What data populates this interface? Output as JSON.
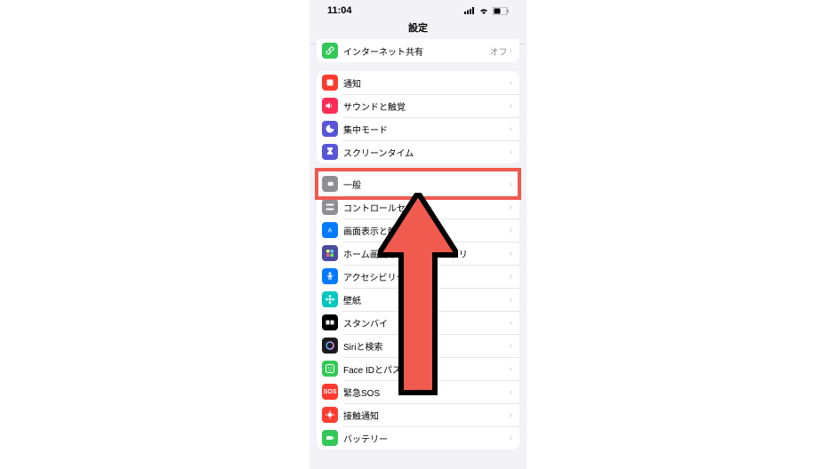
{
  "statusbar": {
    "time": "11:04"
  },
  "header": {
    "title": "設定"
  },
  "groups": [
    {
      "rows": [
        {
          "icon": "link",
          "bg": "#34c759",
          "label": "インターネット共有",
          "detail": "オフ"
        }
      ]
    },
    {
      "rows": [
        {
          "icon": "bell",
          "bg": "#ff3b30",
          "label": "通知"
        },
        {
          "icon": "speaker",
          "bg": "#ff2d55",
          "label": "サウンドと触覚"
        },
        {
          "icon": "moon",
          "bg": "#5856d6",
          "label": "集中モード"
        },
        {
          "icon": "hourglass",
          "bg": "#5856d6",
          "label": "スクリーンタイム"
        }
      ]
    },
    {
      "rows": [
        {
          "icon": "gear",
          "bg": "#8e8e93",
          "label": "一般",
          "highlight": true
        },
        {
          "icon": "switches",
          "bg": "#8e8e93",
          "label": "コントロールセンター"
        },
        {
          "icon": "sun",
          "bg": "#007aff",
          "label": "画面表示と明るさ"
        },
        {
          "icon": "grid",
          "bg": "#4b4ba0",
          "label": "ホーム画面とアプリライブラリ"
        },
        {
          "icon": "access",
          "bg": "#007aff",
          "label": "アクセシビリティ"
        },
        {
          "icon": "flower",
          "bg": "#00c7be",
          "label": "壁紙"
        },
        {
          "icon": "standby",
          "bg": "#000000",
          "label": "スタンバイ"
        },
        {
          "icon": "siri",
          "bg": "#1c1c1e",
          "label": "Siriと検索"
        },
        {
          "icon": "faceid",
          "bg": "#34c759",
          "label": "Face IDとパスコード"
        },
        {
          "icon": "sos",
          "bg": "#ff3b30",
          "label": "緊急SOS"
        },
        {
          "icon": "virus",
          "bg": "#ff3b30",
          "label": "接触通知"
        },
        {
          "icon": "battery",
          "bg": "#34c759",
          "label": "バッテリー"
        }
      ]
    }
  ],
  "annotation": {
    "highlight_color": "#f05a4f"
  }
}
